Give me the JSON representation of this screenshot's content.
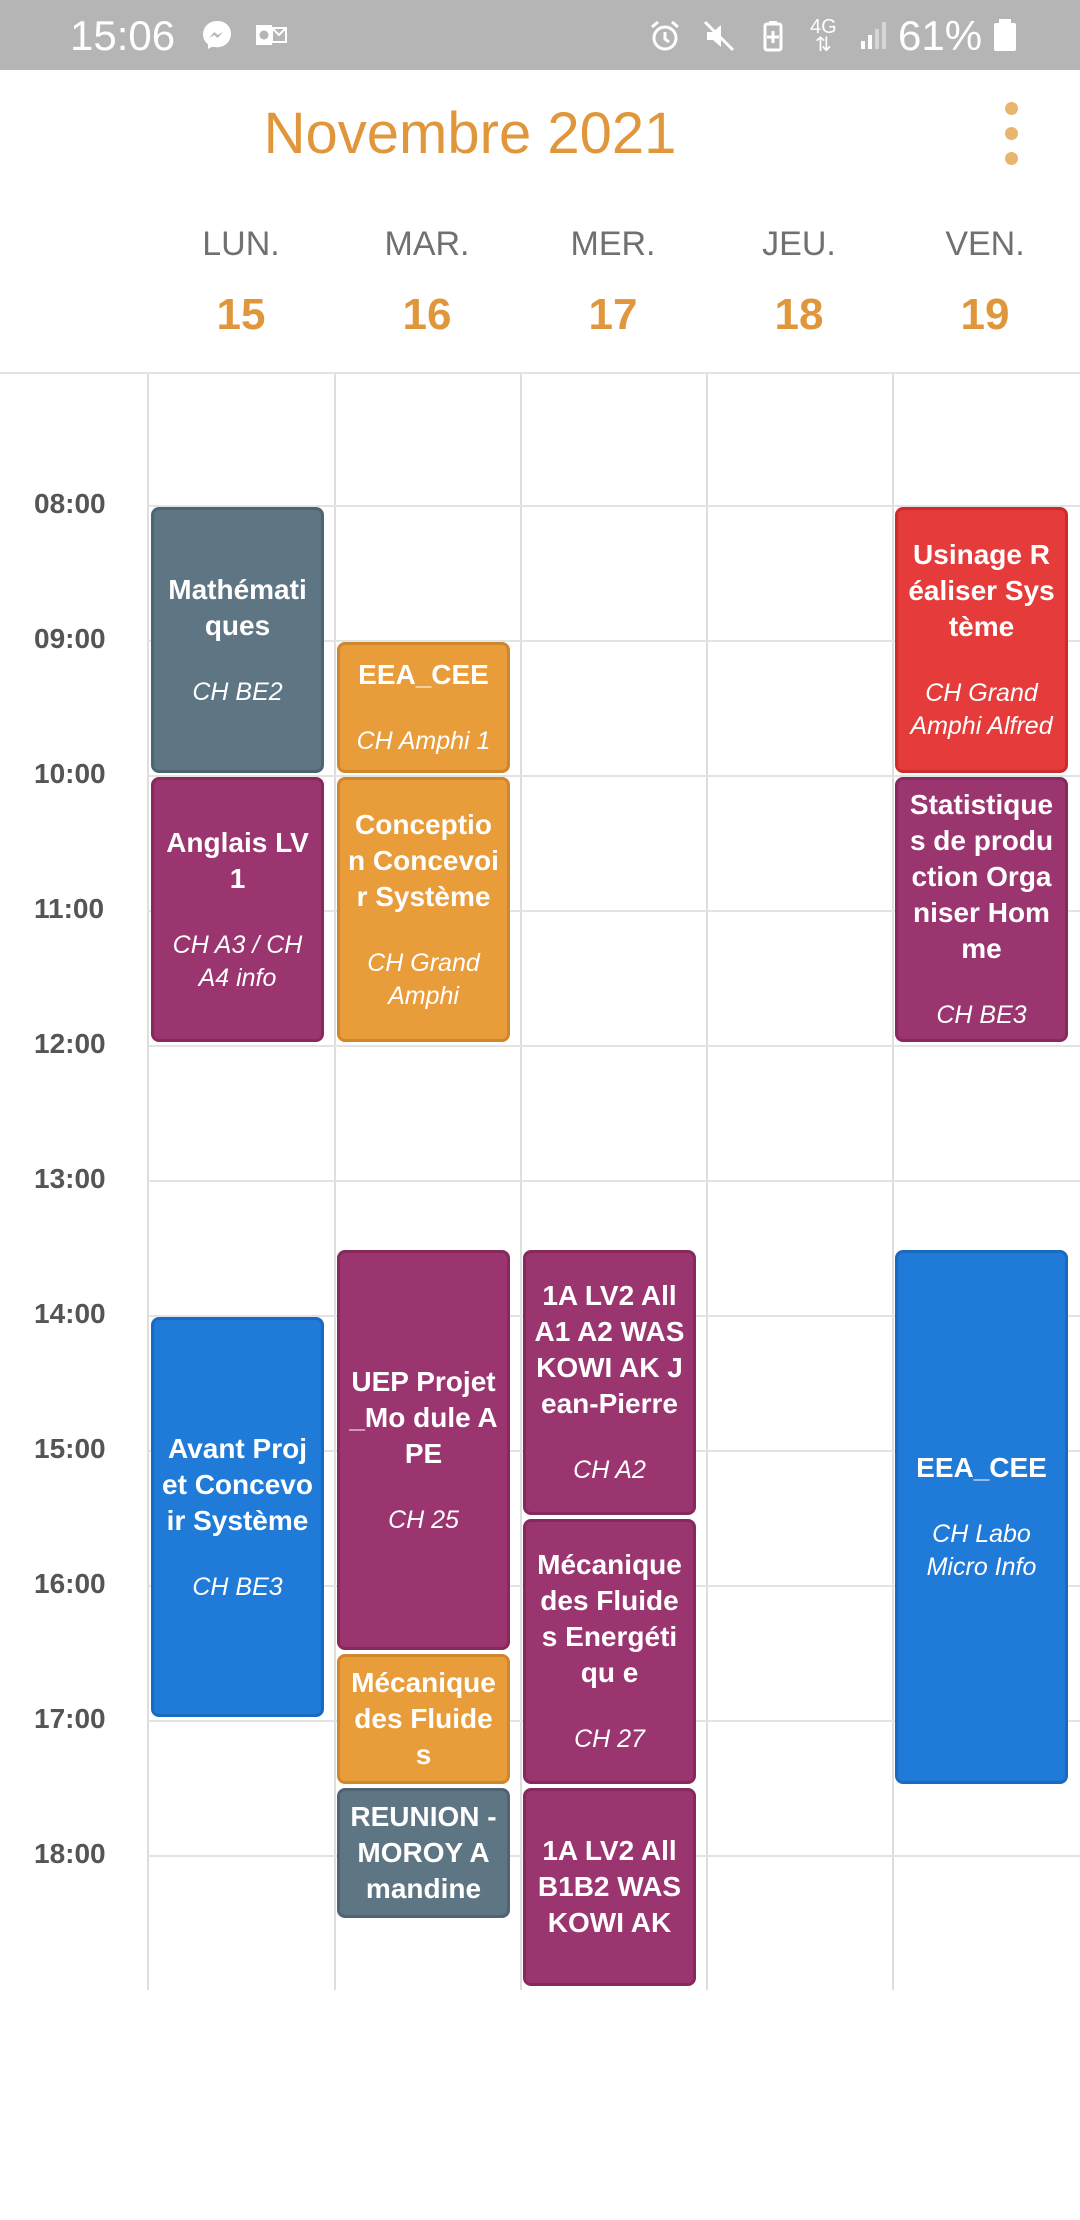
{
  "status_bar": {
    "time": "15:06",
    "network": "4G",
    "battery": "61%",
    "left_icons": [
      "messenger-icon",
      "outlook-icon"
    ],
    "right_icons": [
      "alarm-icon",
      "mute-icon",
      "battery-saver-icon",
      "network-4g-icon",
      "signal-icon"
    ]
  },
  "header": {
    "title": "Novembre 2021",
    "days": [
      {
        "name": "LUN.",
        "num": "15"
      },
      {
        "name": "MAR.",
        "num": "16"
      },
      {
        "name": "MER.",
        "num": "17"
      },
      {
        "name": "JEU.",
        "num": "18"
      },
      {
        "name": "VEN.",
        "num": "19"
      }
    ]
  },
  "hours": [
    "08:00",
    "09:00",
    "10:00",
    "11:00",
    "12:00",
    "13:00",
    "14:00",
    "15:00",
    "16:00",
    "17:00",
    "18:00"
  ],
  "events": {
    "mon_math": {
      "title": "Mathémati ques",
      "room": "CH BE2",
      "day": "LUN.",
      "start": "08:00",
      "end": "10:00"
    },
    "mon_anglais": {
      "title": "Anglais LV1",
      "room": "CH A3 / CH A4  info",
      "day": "LUN.",
      "start": "10:00",
      "end": "12:00"
    },
    "mon_avant_projet": {
      "title": "Avant Projet Concevoir Système",
      "room": "CH BE3",
      "day": "LUN.",
      "start": "14:00",
      "end": "17:00"
    },
    "tue_eea": {
      "title": "EEA_CEE",
      "room": "CH Amphi 1",
      "day": "MAR.",
      "start": "09:00",
      "end": "10:00"
    },
    "tue_conception": {
      "title": "Conceptio n Concevoir Système",
      "room": "CH Grand Amphi",
      "day": "MAR.",
      "start": "10:00",
      "end": "12:00"
    },
    "tue_uep": {
      "title": "UEP Projet_Mo dule APE",
      "room": "CH 25",
      "day": "MAR.",
      "start": "13:30",
      "end": "16:30"
    },
    "tue_meca": {
      "title": "Mécanique des Fluides",
      "day": "MAR.",
      "start": "16:30",
      "end": "17:30"
    },
    "tue_reunion": {
      "title": "REUNION - MOROY Amandine",
      "day": "MAR.",
      "start": "17:30",
      "end": "18:30"
    },
    "wed_lv2_a": {
      "title": "1A LV2 All A1 A2 WASKOWI AK Jean-Pierre",
      "room": "CH A2",
      "day": "MER.",
      "start": "13:30",
      "end": "15:30"
    },
    "wed_meca": {
      "title": "Mécanique des Fluides Energétiqu e",
      "room": "CH 27",
      "day": "MER.",
      "start": "15:30",
      "end": "17:30"
    },
    "wed_lv2_b": {
      "title": "1A LV2 All B1B2 WASKOWI AK",
      "day": "MER.",
      "start": "17:30",
      "end": "19:00"
    },
    "fri_usinage": {
      "title": "Usinage Réaliser Système",
      "room": "CH Grand Amphi Alfred",
      "day": "VEN.",
      "start": "08:00",
      "end": "10:00"
    },
    "fri_stats": {
      "title": "Statistique s de production Organiser Homme",
      "room": "CH BE3",
      "day": "VEN.",
      "start": "10:00",
      "end": "12:00"
    },
    "fri_eea": {
      "title": "EEA_CEE",
      "room": "CH Labo Micro Info",
      "day": "VEN.",
      "start": "13:30",
      "end": "17:30"
    }
  },
  "colors": {
    "accent": "#e0963a",
    "slate": "#5e7583",
    "orange": "#e89c3a",
    "purple": "#9b3570",
    "blue": "#1f7ad8",
    "red": "#e53b3b"
  }
}
